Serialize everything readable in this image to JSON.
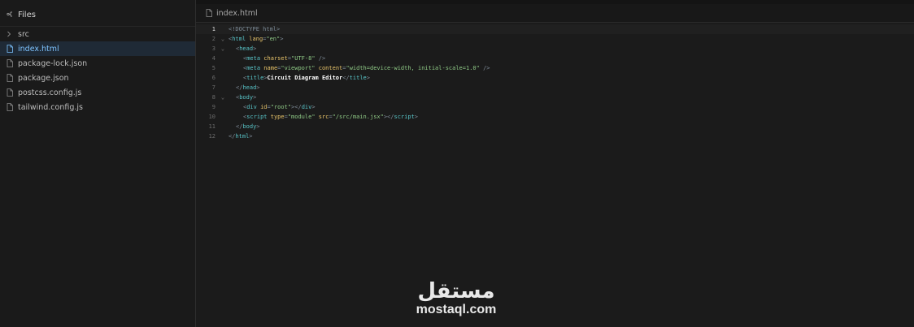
{
  "sidebar": {
    "title": "Files",
    "items": [
      {
        "label": "src",
        "type": "folder"
      },
      {
        "label": "index.html",
        "type": "file",
        "active": true
      },
      {
        "label": "package-lock.json",
        "type": "file"
      },
      {
        "label": "package.json",
        "type": "file"
      },
      {
        "label": "postcss.config.js",
        "type": "file"
      },
      {
        "label": "tailwind.config.js",
        "type": "file"
      }
    ]
  },
  "tab": {
    "label": "index.html"
  },
  "code": {
    "lines": [
      {
        "n": "1",
        "fold": "",
        "indent": 0,
        "tokens": [
          [
            "doc",
            "<!DOCTYPE html>"
          ]
        ]
      },
      {
        "n": "2",
        "fold": "⌄",
        "indent": 0,
        "tokens": [
          [
            "punc",
            "<"
          ],
          [
            "tag",
            "html"
          ],
          [
            "plain",
            " "
          ],
          [
            "attr",
            "lang"
          ],
          [
            "punc",
            "="
          ],
          [
            "str",
            "\"en\""
          ],
          [
            "punc",
            ">"
          ]
        ]
      },
      {
        "n": "3",
        "fold": "⌄",
        "indent": 1,
        "tokens": [
          [
            "punc",
            "<"
          ],
          [
            "tag",
            "head"
          ],
          [
            "punc",
            ">"
          ]
        ]
      },
      {
        "n": "4",
        "fold": "",
        "indent": 2,
        "tokens": [
          [
            "punc",
            "<"
          ],
          [
            "tag",
            "meta"
          ],
          [
            "plain",
            " "
          ],
          [
            "attr",
            "charset"
          ],
          [
            "punc",
            "="
          ],
          [
            "str",
            "\"UTF-8\""
          ],
          [
            "plain",
            " "
          ],
          [
            "punc",
            "/>"
          ]
        ]
      },
      {
        "n": "5",
        "fold": "",
        "indent": 2,
        "tokens": [
          [
            "punc",
            "<"
          ],
          [
            "tag",
            "meta"
          ],
          [
            "plain",
            " "
          ],
          [
            "attr",
            "name"
          ],
          [
            "punc",
            "="
          ],
          [
            "str",
            "\"viewport\""
          ],
          [
            "plain",
            " "
          ],
          [
            "attr",
            "content"
          ],
          [
            "punc",
            "="
          ],
          [
            "str",
            "\"width=device-width, initial-scale=1.0\""
          ],
          [
            "plain",
            " "
          ],
          [
            "punc",
            "/>"
          ]
        ]
      },
      {
        "n": "6",
        "fold": "",
        "indent": 2,
        "tokens": [
          [
            "punc",
            "<"
          ],
          [
            "tag",
            "title"
          ],
          [
            "punc",
            ">"
          ],
          [
            "text",
            "Circuit Diagram Editor"
          ],
          [
            "punc",
            "</"
          ],
          [
            "tag",
            "title"
          ],
          [
            "punc",
            ">"
          ]
        ]
      },
      {
        "n": "7",
        "fold": "",
        "indent": 1,
        "tokens": [
          [
            "punc",
            "</"
          ],
          [
            "tag",
            "head"
          ],
          [
            "punc",
            ">"
          ]
        ]
      },
      {
        "n": "8",
        "fold": "⌄",
        "indent": 1,
        "tokens": [
          [
            "punc",
            "<"
          ],
          [
            "tag",
            "body"
          ],
          [
            "punc",
            ">"
          ]
        ]
      },
      {
        "n": "9",
        "fold": "",
        "indent": 2,
        "tokens": [
          [
            "punc",
            "<"
          ],
          [
            "tag",
            "div"
          ],
          [
            "plain",
            " "
          ],
          [
            "attr",
            "id"
          ],
          [
            "punc",
            "="
          ],
          [
            "str",
            "\"root\""
          ],
          [
            "punc",
            "></"
          ],
          [
            "tag",
            "div"
          ],
          [
            "punc",
            ">"
          ]
        ]
      },
      {
        "n": "10",
        "fold": "",
        "indent": 2,
        "tokens": [
          [
            "punc",
            "<"
          ],
          [
            "tag",
            "script"
          ],
          [
            "plain",
            " "
          ],
          [
            "attr",
            "type"
          ],
          [
            "punc",
            "="
          ],
          [
            "str",
            "\"module\""
          ],
          [
            "plain",
            " "
          ],
          [
            "attr",
            "src"
          ],
          [
            "punc",
            "="
          ],
          [
            "str",
            "\"/src/main.jsx\""
          ],
          [
            "punc",
            "></"
          ],
          [
            "tag",
            "script"
          ],
          [
            "punc",
            ">"
          ]
        ]
      },
      {
        "n": "11",
        "fold": "",
        "indent": 1,
        "tokens": [
          [
            "punc",
            "</"
          ],
          [
            "tag",
            "body"
          ],
          [
            "punc",
            ">"
          ]
        ]
      },
      {
        "n": "12",
        "fold": "",
        "indent": 0,
        "tokens": [
          [
            "punc",
            "</"
          ],
          [
            "tag",
            "html"
          ],
          [
            "punc",
            ">"
          ]
        ]
      }
    ],
    "current_line": "1"
  },
  "watermark": {
    "arabic": "مستقل",
    "latin": "mostaql.com"
  },
  "colors": {
    "accent": "#7ec3ff",
    "tag": "#58c4c8",
    "attr": "#e8c46a",
    "string": "#8fc986"
  }
}
